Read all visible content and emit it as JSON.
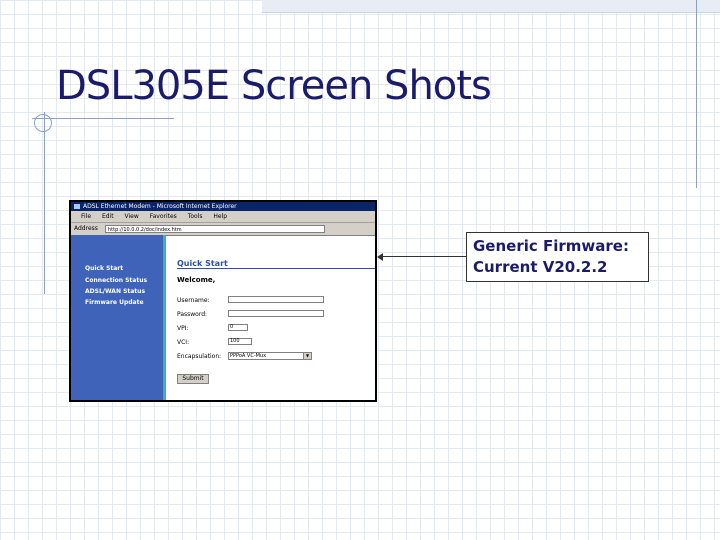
{
  "slide": {
    "title": "DSL305E Screen Shots"
  },
  "browser": {
    "window_title": "ADSL Ethernet Modem - Microsoft Internet Explorer",
    "menu": [
      "File",
      "Edit",
      "View",
      "Favorites",
      "Tools",
      "Help"
    ],
    "address_label": "Address",
    "address_value": "http://10.0.0.2/doc/index.htm",
    "nav_items": [
      "Quick Start",
      "Connection Status",
      "ADSL/WAN Status",
      "Firmware Update"
    ],
    "page": {
      "heading": "Quick Start",
      "welcome": "Welcome,",
      "fields": [
        {
          "label": "Username:",
          "value": ""
        },
        {
          "label": "Password:",
          "value": ""
        },
        {
          "label": "VPI:",
          "value": "0"
        },
        {
          "label": "VCI:",
          "value": "100"
        }
      ],
      "encapsulation_label": "Encapsulation:",
      "encapsulation_value": "PPPoA VC-Mux",
      "submit_label": "Submit"
    }
  },
  "callout": {
    "line1": "Generic Firmware:",
    "line2": "Current V20.2.2"
  },
  "colors": {
    "title": "#1b1b6b",
    "nav_background": "#3e63b8",
    "nav_border": "#40b0b0",
    "heading": "#3050a8"
  }
}
